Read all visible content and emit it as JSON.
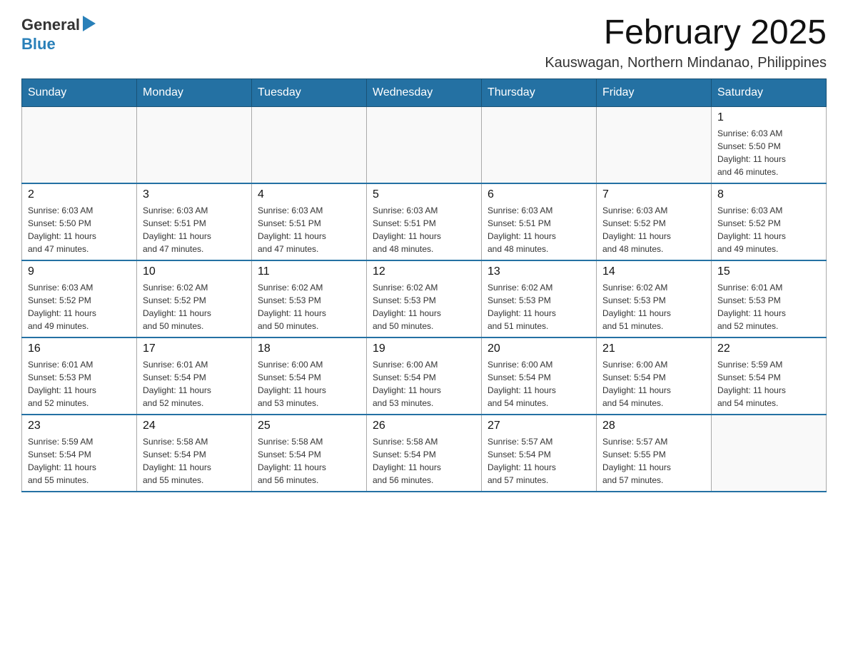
{
  "header": {
    "logo": {
      "text_general": "General",
      "text_blue": "Blue",
      "arrow_unicode": "▶"
    },
    "title": "February 2025",
    "subtitle": "Kauswagan, Northern Mindanao, Philippines"
  },
  "calendar": {
    "days_of_week": [
      "Sunday",
      "Monday",
      "Tuesday",
      "Wednesday",
      "Thursday",
      "Friday",
      "Saturday"
    ],
    "weeks": [
      [
        {
          "day": "",
          "info": ""
        },
        {
          "day": "",
          "info": ""
        },
        {
          "day": "",
          "info": ""
        },
        {
          "day": "",
          "info": ""
        },
        {
          "day": "",
          "info": ""
        },
        {
          "day": "",
          "info": ""
        },
        {
          "day": "1",
          "info": "Sunrise: 6:03 AM\nSunset: 5:50 PM\nDaylight: 11 hours\nand 46 minutes."
        }
      ],
      [
        {
          "day": "2",
          "info": "Sunrise: 6:03 AM\nSunset: 5:50 PM\nDaylight: 11 hours\nand 47 minutes."
        },
        {
          "day": "3",
          "info": "Sunrise: 6:03 AM\nSunset: 5:51 PM\nDaylight: 11 hours\nand 47 minutes."
        },
        {
          "day": "4",
          "info": "Sunrise: 6:03 AM\nSunset: 5:51 PM\nDaylight: 11 hours\nand 47 minutes."
        },
        {
          "day": "5",
          "info": "Sunrise: 6:03 AM\nSunset: 5:51 PM\nDaylight: 11 hours\nand 48 minutes."
        },
        {
          "day": "6",
          "info": "Sunrise: 6:03 AM\nSunset: 5:51 PM\nDaylight: 11 hours\nand 48 minutes."
        },
        {
          "day": "7",
          "info": "Sunrise: 6:03 AM\nSunset: 5:52 PM\nDaylight: 11 hours\nand 48 minutes."
        },
        {
          "day": "8",
          "info": "Sunrise: 6:03 AM\nSunset: 5:52 PM\nDaylight: 11 hours\nand 49 minutes."
        }
      ],
      [
        {
          "day": "9",
          "info": "Sunrise: 6:03 AM\nSunset: 5:52 PM\nDaylight: 11 hours\nand 49 minutes."
        },
        {
          "day": "10",
          "info": "Sunrise: 6:02 AM\nSunset: 5:52 PM\nDaylight: 11 hours\nand 50 minutes."
        },
        {
          "day": "11",
          "info": "Sunrise: 6:02 AM\nSunset: 5:53 PM\nDaylight: 11 hours\nand 50 minutes."
        },
        {
          "day": "12",
          "info": "Sunrise: 6:02 AM\nSunset: 5:53 PM\nDaylight: 11 hours\nand 50 minutes."
        },
        {
          "day": "13",
          "info": "Sunrise: 6:02 AM\nSunset: 5:53 PM\nDaylight: 11 hours\nand 51 minutes."
        },
        {
          "day": "14",
          "info": "Sunrise: 6:02 AM\nSunset: 5:53 PM\nDaylight: 11 hours\nand 51 minutes."
        },
        {
          "day": "15",
          "info": "Sunrise: 6:01 AM\nSunset: 5:53 PM\nDaylight: 11 hours\nand 52 minutes."
        }
      ],
      [
        {
          "day": "16",
          "info": "Sunrise: 6:01 AM\nSunset: 5:53 PM\nDaylight: 11 hours\nand 52 minutes."
        },
        {
          "day": "17",
          "info": "Sunrise: 6:01 AM\nSunset: 5:54 PM\nDaylight: 11 hours\nand 52 minutes."
        },
        {
          "day": "18",
          "info": "Sunrise: 6:00 AM\nSunset: 5:54 PM\nDaylight: 11 hours\nand 53 minutes."
        },
        {
          "day": "19",
          "info": "Sunrise: 6:00 AM\nSunset: 5:54 PM\nDaylight: 11 hours\nand 53 minutes."
        },
        {
          "day": "20",
          "info": "Sunrise: 6:00 AM\nSunset: 5:54 PM\nDaylight: 11 hours\nand 54 minutes."
        },
        {
          "day": "21",
          "info": "Sunrise: 6:00 AM\nSunset: 5:54 PM\nDaylight: 11 hours\nand 54 minutes."
        },
        {
          "day": "22",
          "info": "Sunrise: 5:59 AM\nSunset: 5:54 PM\nDaylight: 11 hours\nand 54 minutes."
        }
      ],
      [
        {
          "day": "23",
          "info": "Sunrise: 5:59 AM\nSunset: 5:54 PM\nDaylight: 11 hours\nand 55 minutes."
        },
        {
          "day": "24",
          "info": "Sunrise: 5:58 AM\nSunset: 5:54 PM\nDaylight: 11 hours\nand 55 minutes."
        },
        {
          "day": "25",
          "info": "Sunrise: 5:58 AM\nSunset: 5:54 PM\nDaylight: 11 hours\nand 56 minutes."
        },
        {
          "day": "26",
          "info": "Sunrise: 5:58 AM\nSunset: 5:54 PM\nDaylight: 11 hours\nand 56 minutes."
        },
        {
          "day": "27",
          "info": "Sunrise: 5:57 AM\nSunset: 5:54 PM\nDaylight: 11 hours\nand 57 minutes."
        },
        {
          "day": "28",
          "info": "Sunrise: 5:57 AM\nSunset: 5:55 PM\nDaylight: 11 hours\nand 57 minutes."
        },
        {
          "day": "",
          "info": ""
        }
      ]
    ]
  }
}
